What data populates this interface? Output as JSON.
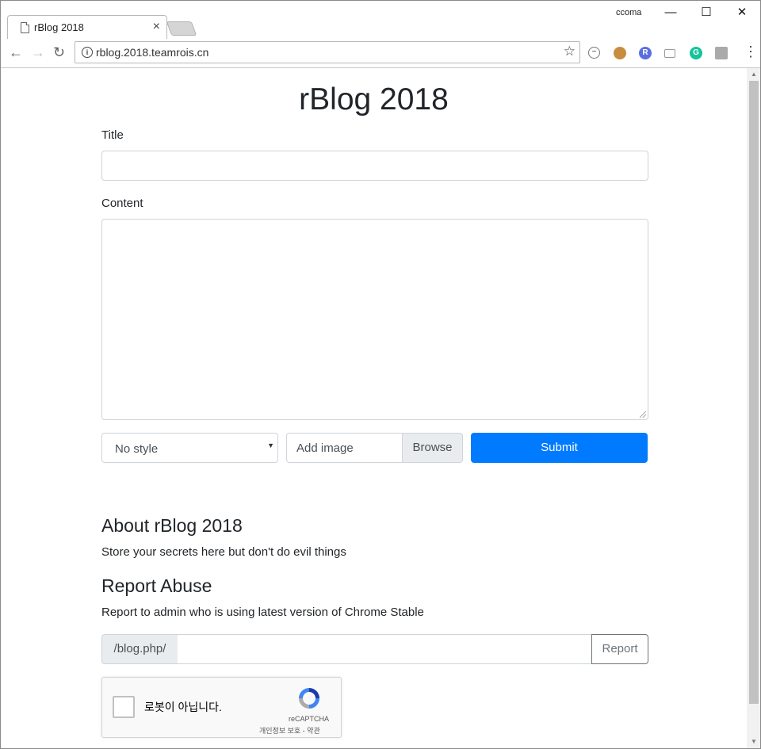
{
  "browser": {
    "tab_title": "rBlog 2018",
    "tab_close": "×",
    "profile_name": "ccoma",
    "window_controls": {
      "minimize": "—",
      "maximize": "☐",
      "close": "✕"
    },
    "url": "rblog.2018.teamrois.cn",
    "extensions": [
      "block-icon",
      "cookie-icon",
      "r-extension-icon",
      "cast-icon",
      "grammarly-icon",
      "pdf-icon"
    ]
  },
  "page": {
    "heading": "rBlog 2018",
    "title_label": "Title",
    "title_value": "",
    "content_label": "Content",
    "content_value": "",
    "style_select": {
      "selected": "No style"
    },
    "file_input": {
      "placeholder": "Add image",
      "browse_label": "Browse"
    },
    "submit_label": "Submit",
    "about_heading": "About rBlog 2018",
    "about_text": "Store your secrets here but don't do evil things",
    "report_heading": "Report Abuse",
    "report_text": "Report to admin who is using latest version of Chrome Stable",
    "report_prefix": "/blog.php/",
    "report_value": "",
    "report_button": "Report",
    "recaptcha": {
      "label": "로봇이 아닙니다.",
      "brand": "reCAPTCHA",
      "links": "개인정보 보호 - 약관"
    }
  },
  "colors": {
    "primary": "#007bff",
    "text": "#212529",
    "input_border": "#ced4da"
  }
}
